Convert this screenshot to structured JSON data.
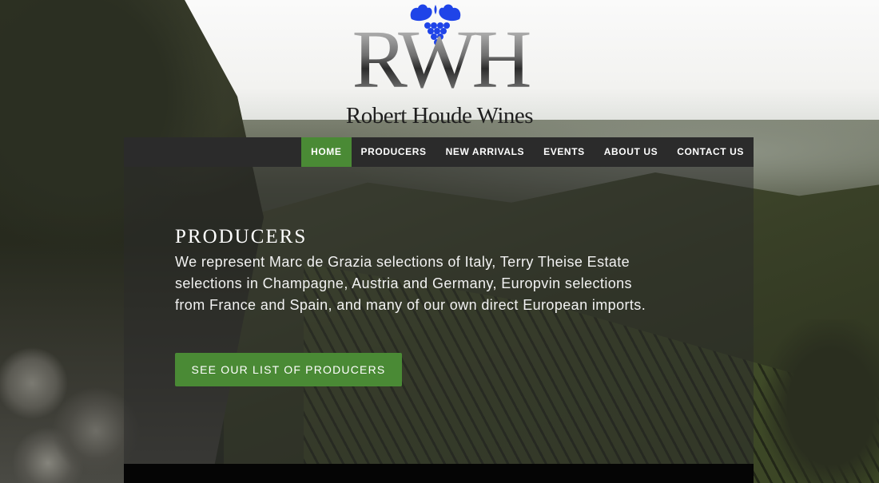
{
  "logo": {
    "monogram": "RWH",
    "wordmark": "Robert Houde Wines",
    "grapes_icon": "grape-cluster-icon",
    "grapes_color": "#1f44e8"
  },
  "nav": {
    "items": [
      {
        "label": "HOME",
        "active": true
      },
      {
        "label": "PRODUCERS",
        "active": false
      },
      {
        "label": "NEW ARRIVALS",
        "active": false
      },
      {
        "label": "EVENTS",
        "active": false
      },
      {
        "label": "ABOUT US",
        "active": false
      },
      {
        "label": "CONTACT US",
        "active": false
      }
    ]
  },
  "hero": {
    "title": "PRODUCERS",
    "text": "We represent Marc de Grazia selections of Italy, Terry Theise Estate selections in Champagne, Austria and Germany, Europvin selections from France and Spain, and many of our own direct European imports.",
    "button_label": "SEE OUR LIST OF PRODUCERS"
  },
  "colors": {
    "accent_green": "#4a8a35",
    "nav_background": "#2b2b2b"
  }
}
